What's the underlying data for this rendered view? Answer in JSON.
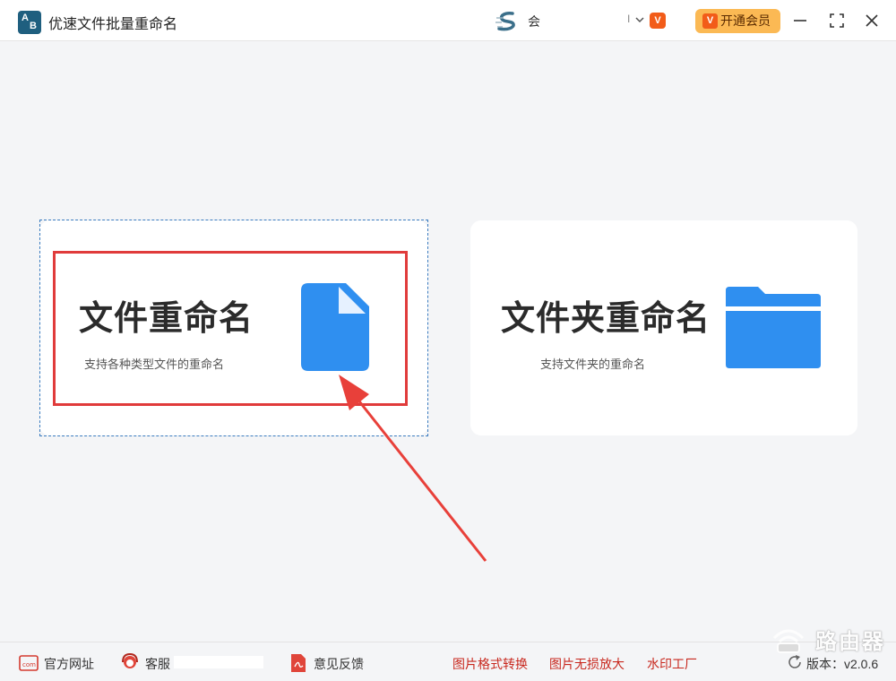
{
  "titlebar": {
    "logo_a": "A",
    "logo_b": "B",
    "title": "优速文件批量重命名",
    "user_name": "会",
    "user_sep": "I",
    "vip_badge": "V",
    "vip_button_icon": "V",
    "vip_button_label": "开通会员"
  },
  "cards": {
    "file": {
      "title": "文件重命名",
      "subtitle": "支持各种类型文件的重命名",
      "icon": "file-icon",
      "icon_color": "#2f8ff0"
    },
    "folder": {
      "title": "文件夹重命名",
      "subtitle": "支持文件夹的重命名",
      "icon": "folder-icon",
      "icon_color": "#2f8ff0"
    }
  },
  "annotation": {
    "highlight_color": "#e03b3b",
    "arrow_color": "#e8403a"
  },
  "footer": {
    "website": "官方网址",
    "service": "客服",
    "feedback": "意见反馈",
    "link_image_convert": "图片格式转换",
    "link_image_enlarge": "图片无损放大",
    "link_watermark": "水印工厂",
    "version_label": "版本：v2.0.6"
  },
  "watermark": {
    "text": "路由器"
  },
  "colors": {
    "accent": "#2f8ff0",
    "vip": "#fbb954",
    "link": "#c8281e",
    "background": "#f4f5f7"
  }
}
